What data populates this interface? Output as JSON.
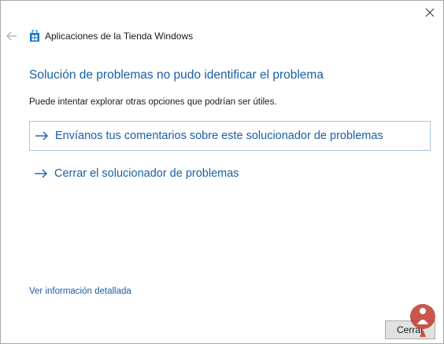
{
  "window": {
    "close_glyph": "✕"
  },
  "header": {
    "app_title": "Aplicaciones de la Tienda Windows"
  },
  "main": {
    "heading": "Solución de problemas no pudo identificar el problema",
    "subtext": "Puede intentar explorar otras opciones que podrían ser útiles.",
    "options": [
      {
        "label": "Envíanos tus comentarios sobre este solucionador de problemas",
        "icon": "arrow-right-icon"
      },
      {
        "label": "Cerrar el solucionador de problemas",
        "icon": "arrow-right-icon"
      }
    ],
    "details_link": "Ver información detallada"
  },
  "footer": {
    "close_button": "Cerrar"
  },
  "colors": {
    "accent": "#1a5fa6",
    "focus_border": "#a8c4e6",
    "button_bg": "#e1e1e1"
  }
}
